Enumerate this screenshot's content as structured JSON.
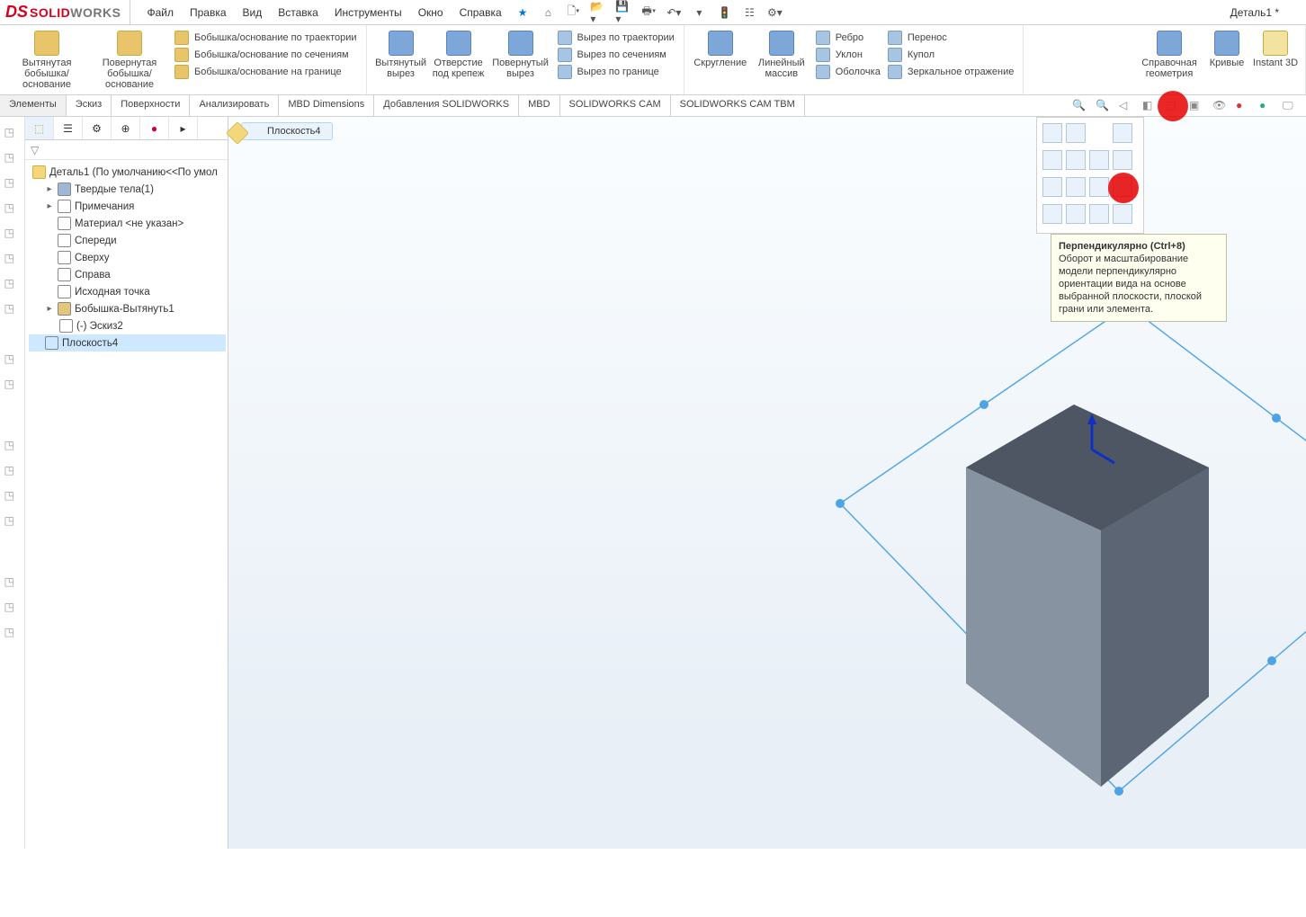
{
  "document_title": "Деталь1 *",
  "logo": {
    "prefix": "DS",
    "solid": "SOLID",
    "works": "WORKS"
  },
  "menus": [
    "Файл",
    "Правка",
    "Вид",
    "Вставка",
    "Инструменты",
    "Окно",
    "Справка"
  ],
  "ribbon": {
    "boss_extrude": "Вытянутая бобышка/основание",
    "boss_revolve": "Повернутая бобышка/основание",
    "sweep": "Бобышка/основание по траектории",
    "loft": "Бобышка/основание по сечениям",
    "boundary": "Бобышка/основание на границе",
    "cut_extrude": "Вытянутый вырез",
    "hole_wizard": "Отверстие под крепеж",
    "cut_revolve": "Повернутый вырез",
    "cut_sweep": "Вырез по траектории",
    "cut_loft": "Вырез по сечениям",
    "cut_boundary": "Вырез по границе",
    "fillet": "Скругление",
    "linear_pattern": "Линейный массив",
    "rib": "Ребро",
    "draft": "Уклон",
    "shell": "Оболочка",
    "wrap": "Перенос",
    "dome": "Купол",
    "mirror": "Зеркальное отражение",
    "ref_geom": "Справочная геометрия",
    "curves": "Кривые",
    "instant3d": "Instant 3D"
  },
  "cmdtabs": [
    "Элементы",
    "Эскиз",
    "Поверхности",
    "Анализировать",
    "MBD Dimensions",
    "Добавления SOLIDWORKS",
    "MBD",
    "SOLIDWORKS CAM",
    "SOLIDWORKS CAM TBM"
  ],
  "tree": {
    "root": "Деталь1  (По умолчанию<<По умол",
    "solid_bodies": "Твердые тела(1)",
    "annotations": "Примечания",
    "material": "Материал <не указан>",
    "front": "Спереди",
    "top": "Сверху",
    "right": "Справа",
    "origin": "Исходная точка",
    "boss1": "Бобышка-Вытянуть1",
    "sketch2": "(-) Эскиз2",
    "plane4": "Плоскость4"
  },
  "breadcrumb": "Плоскость4",
  "tooltip": {
    "title": "Перпендикулярно  (Ctrl+8)",
    "body": "Оборот и масштабирование модели перпендикулярно ориентации вида на основе выбранной плоскости, плоской грани или элемента."
  }
}
